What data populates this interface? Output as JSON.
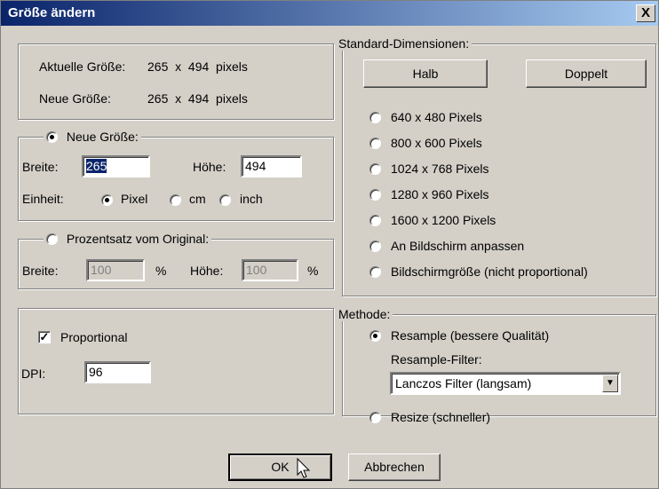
{
  "window": {
    "title": "Größe ändern",
    "close_label": "X"
  },
  "size_info": {
    "current_label": "Aktuelle Größe:",
    "current_value": "265  x  494  pixels",
    "new_label": "Neue Größe:",
    "new_value": "265  x  494  pixels"
  },
  "new_size": {
    "legend": "Neue Größe:",
    "selected": true,
    "width_label": "Breite:",
    "width_value": "265",
    "height_label": "Höhe:",
    "height_value": "494",
    "unit_label": "Einheit:",
    "units": [
      {
        "label": "Pixel",
        "selected": true
      },
      {
        "label": "cm",
        "selected": false
      },
      {
        "label": "inch",
        "selected": false
      }
    ]
  },
  "percent": {
    "legend": "Prozentsatz vom Original:",
    "selected": false,
    "width_label": "Breite:",
    "width_value": "100",
    "height_label": "Höhe:",
    "height_value": "100",
    "percent_sign": "%"
  },
  "options": {
    "proportional_label": "Proportional",
    "proportional_checked": true,
    "dpi_label": "DPI:",
    "dpi_value": "96"
  },
  "standard": {
    "legend": "Standard-Dimensionen:",
    "half_label": "Halb",
    "double_label": "Doppelt",
    "items": [
      {
        "label": "640 x 480 Pixels",
        "selected": false
      },
      {
        "label": "800 x 600 Pixels",
        "selected": false
      },
      {
        "label": "1024 x 768 Pixels",
        "selected": false
      },
      {
        "label": "1280 x 960 Pixels",
        "selected": false
      },
      {
        "label": "1600 x 1200 Pixels",
        "selected": false
      },
      {
        "label": "An Bildschirm anpassen",
        "selected": false
      },
      {
        "label": "Bildschirmgröße (nicht proportional)",
        "selected": false
      }
    ]
  },
  "method": {
    "legend": "Methode:",
    "resample_label": "Resample (bessere Qualität)",
    "resample_selected": true,
    "filter_label": "Resample-Filter:",
    "filter_value": "Lanczos Filter (langsam)",
    "resize_label": "Resize (schneller)",
    "resize_selected": false
  },
  "buttons": {
    "ok_label": "OK",
    "cancel_label": "Abbrechen"
  }
}
